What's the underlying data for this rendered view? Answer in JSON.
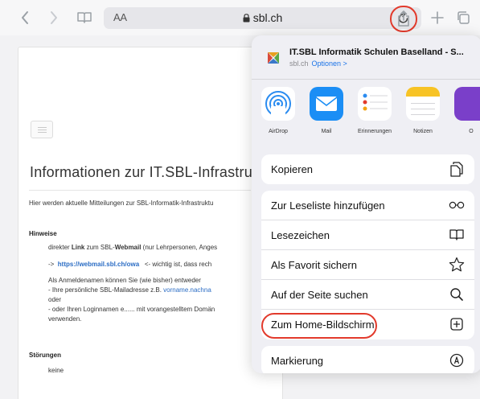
{
  "toolbar": {
    "text_size_label": "AA",
    "url": "sbl.ch",
    "icons": [
      "back-icon",
      "forward-icon",
      "bookmarks-icon",
      "lock-icon",
      "reload-icon",
      "share-icon",
      "plus-icon",
      "tabs-icon"
    ]
  },
  "webpage": {
    "title": "Informationen zur IT.SBL-Infrastru",
    "intro": "Hier werden aktuelle Mitteilungen zur SBL-Informatik-Infrastruktu",
    "hinweise_heading": "Hinweise",
    "lines": {
      "webmail_a": "direkter ",
      "webmail_b": "Link",
      "webmail_c": " zum SBL-",
      "webmail_d": "Webmail",
      "webmail_e": " (nur Lehrpersonen, Anges",
      "arrow": "->",
      "webmail_link": "https://webmail.sbl.ch/owa",
      "webmail_note": "<- wichtig ist, dass rech",
      "login_1": "Als Anmeldenamen können Sie (wie bisher) entweder",
      "login_2a": "- Ihre persönliche SBL-Mailadresse  z.B.  ",
      "login_2b": "vorname.nachna",
      "login_3": "oder",
      "login_4": "- oder Ihren Loginnamen e...... mit vorangestelltem Domän",
      "login_5": "verwenden."
    },
    "stoerungen_heading": "Störungen",
    "stoerungen_text": "keine"
  },
  "share_sheet": {
    "site_title": "IT.SBL Informatik Schulen Baselland - S...",
    "site_domain": "sbl.ch",
    "options_link": "Optionen >",
    "apps": [
      {
        "label": "AirDrop",
        "icon": "airdrop-icon"
      },
      {
        "label": "Mail",
        "icon": "mail-icon"
      },
      {
        "label": "Erinnerungen",
        "icon": "reminders-icon"
      },
      {
        "label": "Notizen",
        "icon": "notes-icon"
      },
      {
        "label": "O",
        "icon": "app-icon"
      }
    ],
    "group1": [
      {
        "label": "Kopieren",
        "icon": "copy-icon"
      }
    ],
    "group2": [
      {
        "label": "Zur Leseliste hinzufügen",
        "icon": "glasses-icon"
      },
      {
        "label": "Lesezeichen",
        "icon": "book-icon"
      },
      {
        "label": "Als Favorit sichern",
        "icon": "star-icon"
      },
      {
        "label": "Auf der Seite suchen",
        "icon": "search-icon"
      },
      {
        "label": "Zum Home-Bildschirm",
        "icon": "add-square-icon"
      }
    ],
    "group3": [
      {
        "label": "Markierung",
        "icon": "markup-icon"
      }
    ]
  },
  "colors": {
    "highlight_ring": "#e23a2c",
    "link_blue": "#1a73e8"
  }
}
